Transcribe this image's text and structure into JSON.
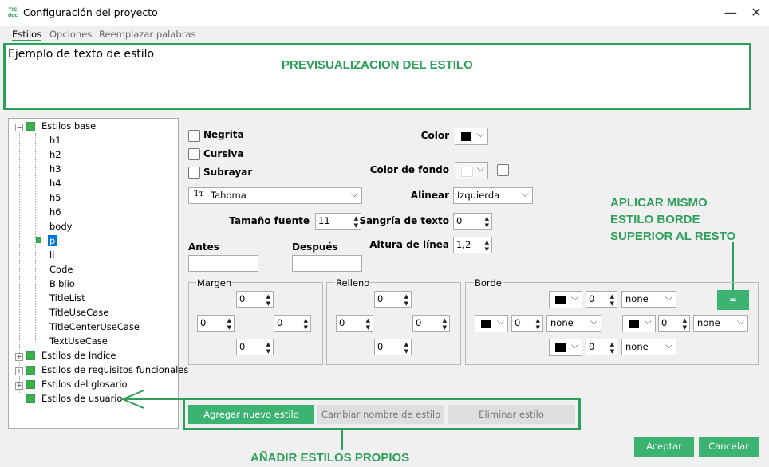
{
  "window": {
    "app_icon_text": "TIC\ndoc",
    "title": "Configuración del proyecto",
    "minimize_glyph": "—",
    "close_glyph": "✕"
  },
  "menu": [
    "Estilos",
    "Opciones",
    "Reemplazar palabras"
  ],
  "preview": {
    "sample_text": "Ejemplo de texto de estilo",
    "annotation": "PREVISUALIZACION DEL ESTILO"
  },
  "tree": {
    "root_base": "Estilos base",
    "base_children": [
      "h1",
      "h2",
      "h3",
      "h4",
      "h5",
      "h6",
      "body",
      "p",
      "li",
      "Code",
      "Biblio",
      "TitleList",
      "TitleUseCase",
      "TitleCenterUseCase",
      "TextUseCase"
    ],
    "selected": "p",
    "roots": [
      "Estilos de Indice",
      "Estilos de requisitos funcionales",
      "Estilos del glosario",
      "Estilos de usuario"
    ],
    "expand_glyph": "+",
    "collapse_glyph": "−"
  },
  "format": {
    "bold": "Negrita",
    "italic": "Cursiva",
    "underline": "Subrayar",
    "font_icon": "Tт",
    "font": "Tahoma",
    "font_size_label": "Tamaño fuente",
    "font_size": "11",
    "before_label": "Antes",
    "after_label": "Después",
    "color_label": "Color",
    "bg_color_label": "Color de fondo",
    "align_label": "Alinear",
    "align_value": "Izquierda",
    "indent_label": "Sangría de texto",
    "indent_value": "0",
    "line_height_label": "Altura de línea",
    "line_height_value": "1,2"
  },
  "margin": {
    "label": "Margen",
    "top": "0",
    "left": "0",
    "right": "0",
    "bottom": "0"
  },
  "padding": {
    "label": "Relleno",
    "top": "0",
    "left": "0",
    "right": "0",
    "bottom": "0"
  },
  "border": {
    "label": "Borde",
    "top_width": "0",
    "top_style": "none",
    "left_width": "0",
    "left_style": "none",
    "right_width": "0",
    "right_style": "none",
    "bottom_width": "0",
    "bottom_style": "none",
    "apply_all": "="
  },
  "annotations": {
    "border_callout_1": "APLICAR MISMO",
    "border_callout_2": "ESTILO BORDE",
    "border_callout_3": "SUPERIOR AL RESTO",
    "add_styles": "AÑADIR ESTILOS PROPIOS"
  },
  "actions": {
    "add": "Agregar nuevo estilo",
    "rename": "Cambiar nombre de estilo",
    "delete": "Eliminar estilo"
  },
  "footer": {
    "accept": "Aceptar",
    "cancel": "Cancelar"
  },
  "glyphs": {
    "spin": "▲\n▼",
    "chevron": "⌵"
  },
  "colors": {
    "accent": "#2e9e5b",
    "button_green": "#3cb371",
    "swatch": "#000000",
    "selection": "#0078d7"
  }
}
